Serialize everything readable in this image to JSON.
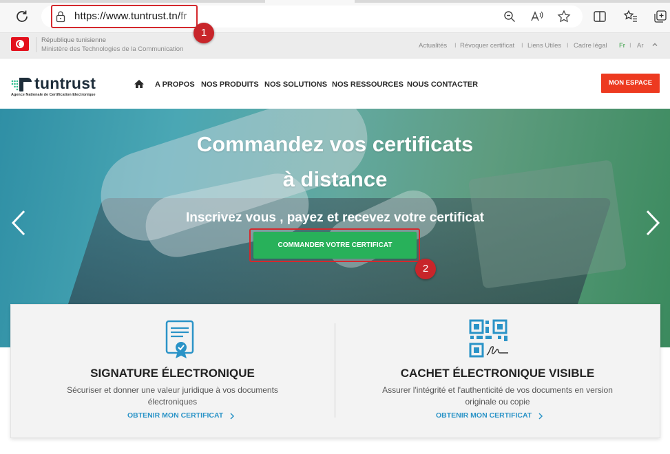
{
  "browser": {
    "url_host": "https://www.tuntrust.tn/",
    "url_path": "fr"
  },
  "annotations": [
    {
      "number": "1"
    },
    {
      "number": "2"
    }
  ],
  "gov": {
    "name": "République tunisienne",
    "ministry": "Ministère des Technologies de la Communication",
    "links": [
      "Actualités",
      "Révoquer certificat",
      "Liens Utiles",
      "Cadre légal"
    ],
    "separator": "I",
    "lang_fr": "Fr",
    "lang_ar": "Ar"
  },
  "header": {
    "logo_text": "tuntrust",
    "logo_sub": "Agence Nationale de Certification Electronique",
    "nav": [
      "A PROPOS",
      "NOS PRODUITS",
      "NOS SOLUTIONS",
      "NOS RESSOURCES",
      "NOUS CONTACTER"
    ],
    "espace_label": "MON ESPACE"
  },
  "hero": {
    "title_line1": "Commandez vos certificats",
    "title_line2": "à distance",
    "subtitle": "Inscrivez vous , payez et recevez votre certificat",
    "cta_label": "COMMANDER VOTRE CERTIFICAT"
  },
  "cards": [
    {
      "title": "SIGNATURE ÉLECTRONIQUE",
      "desc_line1": "Sécuriser et donner une valeur juridique à vos documents",
      "desc_line2": "électroniques",
      "link": "OBTENIR MON CERTIFICAT",
      "icon": "certificate-icon"
    },
    {
      "title": "CACHET ÉLECTRONIQUE VISIBLE",
      "desc_line1": "Assurer l'intégrité et l'authenticité de vos documents en version",
      "desc_line2": "originale ou copie",
      "link": "OBTENIR MON CERTIFICAT",
      "icon": "qr-code-icon"
    }
  ],
  "colors": {
    "accent_red": "#ed3a20",
    "cta_green": "#28b15a",
    "link_blue": "#2a93c7",
    "annotation_red": "#d4282d"
  }
}
